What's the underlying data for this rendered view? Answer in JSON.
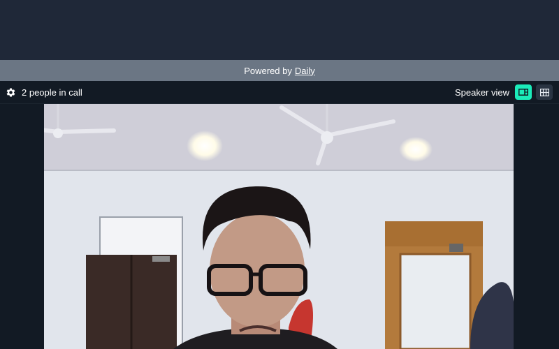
{
  "banner": {
    "prefix": "Powered by",
    "link_text": "Daily"
  },
  "call_bar": {
    "settings_icon": "gear-icon",
    "participants_text": "2 people in call",
    "view_label": "Speaker view",
    "speaker_view_icon": "speaker-layout-icon",
    "grid_view_icon": "grid-layout-icon",
    "active_color": "#1bebb9"
  },
  "video": {
    "content": "participant camera feed"
  }
}
